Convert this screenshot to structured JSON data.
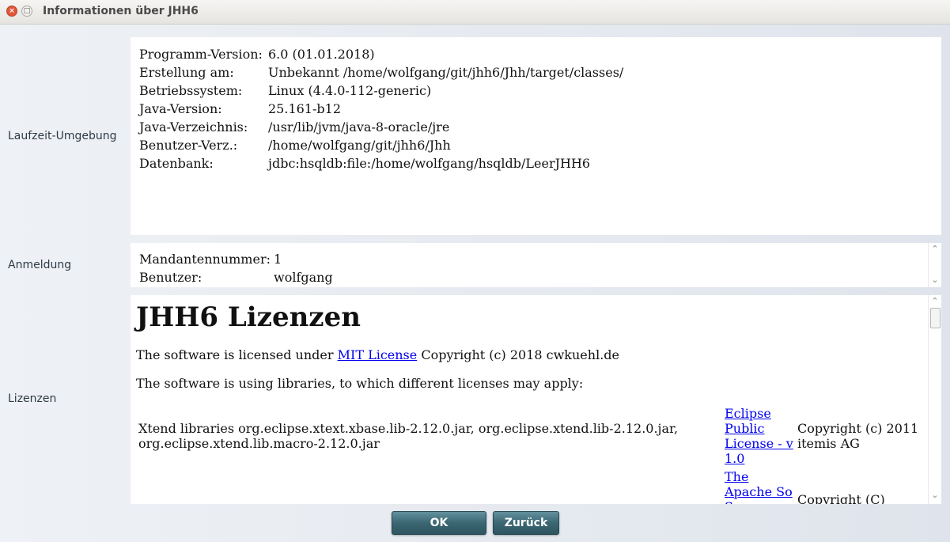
{
  "window": {
    "title": "Informationen über JHH6",
    "close_glyph": "×",
    "maximize_glyph": "□"
  },
  "sections": {
    "runtime_label": "Laufzeit-Umgebung",
    "login_label": "Anmeldung",
    "licenses_label": "Lizenzen"
  },
  "runtime": {
    "rows": [
      {
        "key": "Programm-Version:",
        "value": "6.0 (01.01.2018)"
      },
      {
        "key": "Erstellung am:",
        "value": "Unbekannt /home/wolfgang/git/jhh6/Jhh/target/classes/"
      },
      {
        "key": "Betriebssystem:",
        "value": "Linux (4.4.0-112-generic)"
      },
      {
        "key": "Java-Version:",
        "value": "25.161-b12"
      },
      {
        "key": "Java-Verzeichnis:",
        "value": "/usr/lib/jvm/java-8-oracle/jre"
      },
      {
        "key": "Benutzer-Verz.:",
        "value": "/home/wolfgang/git/jhh6/Jhh"
      },
      {
        "key": "Datenbank:",
        "value": "jdbc:hsqldb:file:/home/wolfgang/hsqldb/LeerJHH6"
      }
    ]
  },
  "login": {
    "rows": [
      {
        "key": "Mandantennummer:",
        "value": "1"
      },
      {
        "key": "Benutzer:",
        "value": "wolfgang"
      }
    ]
  },
  "licenses": {
    "heading": "JHH6 Lizenzen",
    "intro_prefix": "The software is licensed under ",
    "intro_link": "MIT License",
    "intro_suffix": " Copyright (c) 2018 cwkuehl.de",
    "libraries_intro": "The software is using libraries, to which different licenses may apply:",
    "libraries": [
      {
        "description": "Xtend libraries org.eclipse.xtext.xbase.lib-2.12.0.jar, org.eclipse.xtend.lib-2.12.0.jar, org.eclipse.xtend.lib.macro-2.12.0.jar",
        "license_link": "Eclipse Public License - v 1.0",
        "copyright": "Copyright (c) 2011 itemis AG"
      },
      {
        "description": "",
        "license_link": "The Apache So So...",
        "copyright": "Copyright (C)"
      }
    ]
  },
  "buttons": {
    "ok": "OK",
    "back": "Zurück"
  },
  "scroll_arrows": {
    "up": "⌃",
    "down": "⌄"
  }
}
